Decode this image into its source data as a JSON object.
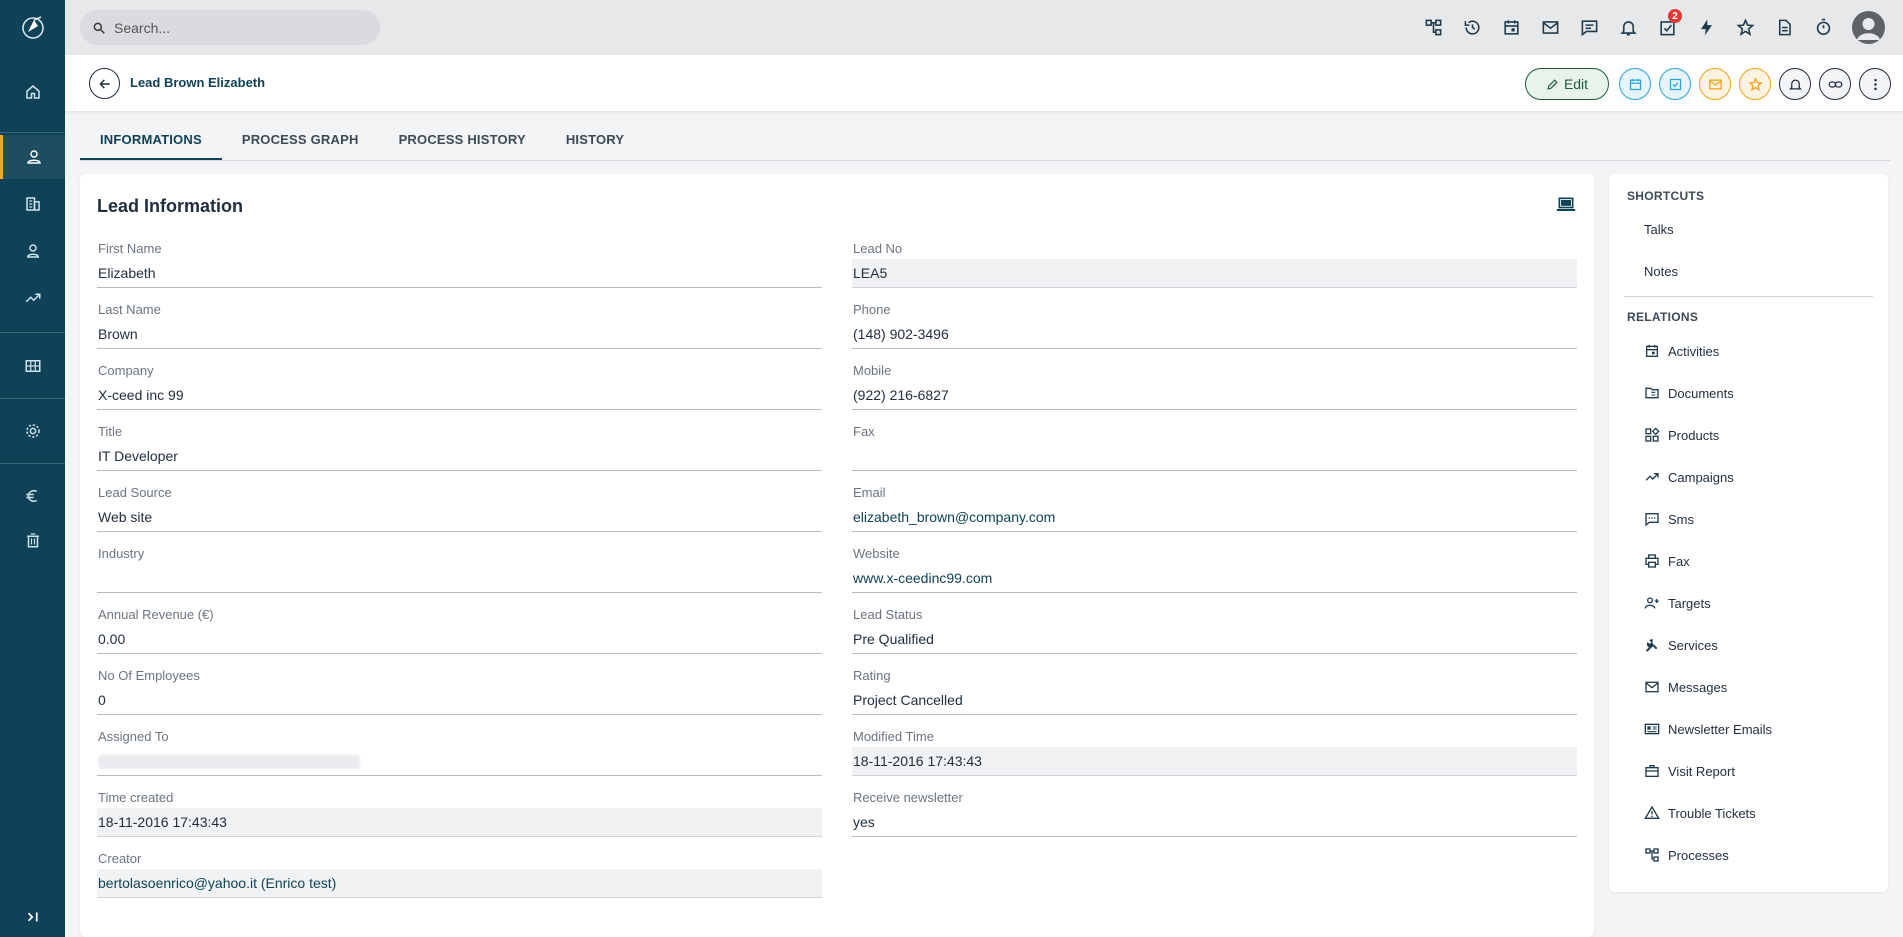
{
  "colors": {
    "rail": "#0f4257",
    "accent": "#f5a623",
    "edit_green": "#1e5b3c",
    "calendar_blue": "#29a3d6",
    "mail_orange": "#f0a01c",
    "dark": "#1f2d3d"
  },
  "rail": {
    "logo": "app-logo-icon",
    "items": [
      "home-icon",
      "lead-person-icon",
      "building-icon",
      "contact-icon",
      "trending-up-icon",
      "grid-icon",
      "settings-icon",
      "euro-icon",
      "trash-icon",
      "expand-icon"
    ]
  },
  "topbar": {
    "search_placeholder": "Search...",
    "icons": [
      "process-tree-icon",
      "history-icon",
      "calendar-icon",
      "mail-icon",
      "chat-icon",
      "bell-icon",
      "tasks-icon",
      "bolt-icon",
      "star-icon",
      "document-icon",
      "timer-icon"
    ],
    "tasks_badge": "2"
  },
  "header": {
    "title": "Lead Brown Elizabeth",
    "edit_label": "Edit",
    "action_icons": [
      "calendar-icon",
      "task-check-icon",
      "mail-icon",
      "star-icon",
      "bell-icon",
      "link-icon",
      "more-vertical-icon"
    ]
  },
  "tabs": [
    {
      "label": "INFORMATIONS",
      "active": true
    },
    {
      "label": "PROCESS GRAPH",
      "active": false
    },
    {
      "label": "PROCESS HISTORY",
      "active": false
    },
    {
      "label": "HISTORY",
      "active": false
    }
  ],
  "lead_info": {
    "title": "Lead Information",
    "left": [
      {
        "label": "First Name",
        "value": "Elizabeth"
      },
      {
        "label": "Last Name",
        "value": "Brown"
      },
      {
        "label": "Company",
        "value": "X-ceed inc 99"
      },
      {
        "label": "Title",
        "value": "IT Developer"
      },
      {
        "label": "Lead Source",
        "value": "Web site"
      },
      {
        "label": "Industry",
        "value": ""
      },
      {
        "label": "Annual Revenue (€)",
        "value": "0.00"
      },
      {
        "label": "No Of Employees",
        "value": "0"
      },
      {
        "label": "Assigned To",
        "value": ""
      },
      {
        "label": "Time created",
        "value": "18-11-2016 17:43:43"
      },
      {
        "label": "Creator",
        "value": "bertolasoenrico@yahoo.it (Enrico test)"
      }
    ],
    "right": [
      {
        "label": "Lead No",
        "value": "LEA5"
      },
      {
        "label": "Phone",
        "value": "(148) 902-3496"
      },
      {
        "label": "Mobile",
        "value": "(922) 216-6827"
      },
      {
        "label": "Fax",
        "value": ""
      },
      {
        "label": "Email",
        "value": "elizabeth_brown@company.com"
      },
      {
        "label": "Website",
        "value": "www.x-ceedinc99.com"
      },
      {
        "label": "Lead Status",
        "value": "Pre Qualified"
      },
      {
        "label": "Rating",
        "value": "Project Cancelled"
      },
      {
        "label": "Modified Time",
        "value": "18-11-2016 17:43:43"
      },
      {
        "label": "Receive newsletter",
        "value": "yes"
      }
    ]
  },
  "shortcuts": {
    "title": "SHORTCUTS",
    "items": [
      "Talks",
      "Notes"
    ]
  },
  "relations": {
    "title": "RELATIONS",
    "items": [
      {
        "label": "Activities",
        "icon": "calendar-icon"
      },
      {
        "label": "Documents",
        "icon": "folder-icon"
      },
      {
        "label": "Products",
        "icon": "widgets-icon"
      },
      {
        "label": "Campaigns",
        "icon": "trending-up-icon"
      },
      {
        "label": "Sms",
        "icon": "sms-icon"
      },
      {
        "label": "Fax",
        "icon": "printer-icon"
      },
      {
        "label": "Targets",
        "icon": "group-add-icon"
      },
      {
        "label": "Services",
        "icon": "wrench-icon"
      },
      {
        "label": "Messages",
        "icon": "mail-icon"
      },
      {
        "label": "Newsletter Emails",
        "icon": "contact-card-icon"
      },
      {
        "label": "Visit Report",
        "icon": "briefcase-icon"
      },
      {
        "label": "Trouble Tickets",
        "icon": "warning-icon"
      },
      {
        "label": "Processes",
        "icon": "process-tree-icon"
      }
    ]
  }
}
